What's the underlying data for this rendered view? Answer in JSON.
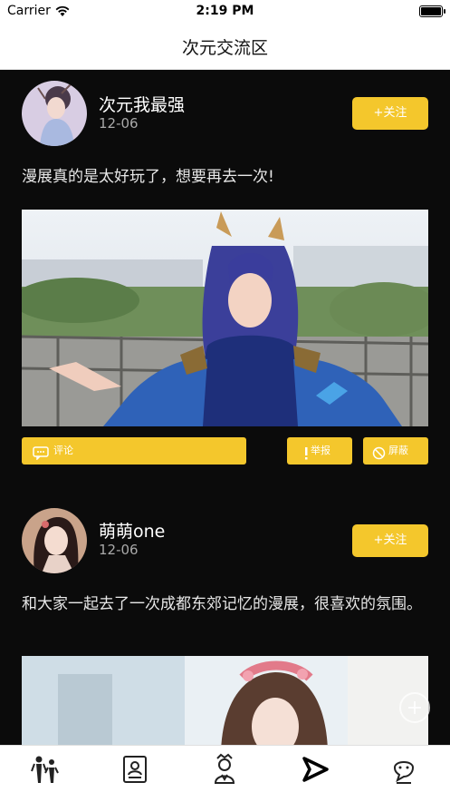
{
  "status_bar": {
    "carrier": "Carrier",
    "time": "2:19 PM"
  },
  "header": {
    "title": "次元交流区"
  },
  "posts": [
    {
      "username": "次元我最强",
      "date": "12-06",
      "follow_label": "+关注",
      "text": "漫展真的是太好玩了，想要再去一次!",
      "actions": {
        "comment": "评论",
        "report": "举报",
        "block": "屏蔽"
      }
    },
    {
      "username": "萌萌one",
      "date": "12-06",
      "follow_label": "+关注",
      "text": "和大家一起去了一次成都东郊记忆的漫展，很喜欢的氛围。"
    }
  ],
  "colors": {
    "accent": "#f4c72c",
    "background": "#0b0b0b",
    "tabbar": "#ffffff"
  },
  "tab_bar": {
    "items": [
      {
        "icon": "people-icon",
        "active": false
      },
      {
        "icon": "id-card-icon",
        "active": false
      },
      {
        "icon": "character-icon",
        "active": false
      },
      {
        "icon": "send-icon",
        "active": true
      },
      {
        "icon": "chat-icon",
        "active": false
      }
    ]
  }
}
